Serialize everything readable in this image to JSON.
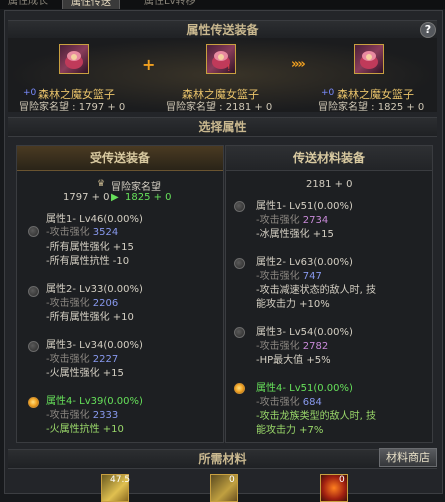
{
  "tabs": [
    {
      "label": "属性成长"
    },
    {
      "label": "属性传送"
    },
    {
      "label": "属性Lv转移"
    }
  ],
  "headers": {
    "transfer_equipment": "属性传送装备",
    "select_attribute": "选择属性",
    "required_materials": "所需材料"
  },
  "help_label": "?",
  "transfer": {
    "left": {
      "stack": "+0",
      "name": "森林之魔女篮子",
      "reputation": "冒险家名望 : 1797 + 0"
    },
    "center": {
      "name": "森林之魔女篮子",
      "reputation": "冒险家名望 : 2181 + 0"
    },
    "right": {
      "stack": "+0",
      "name": "森林之魔女篮子",
      "reputation": "冒险家名望 : 1825 + 0"
    },
    "plus_symbol": "+",
    "arrow_symbol": "»»"
  },
  "receiver_panel": {
    "title": "受传送装备",
    "rep_label": "冒险家名望",
    "rep_from": "1797 + 0",
    "rep_arrow": "▶",
    "rep_to": "1825 + 0",
    "attributes": [
      {
        "title": "属性1- Lv46(0.00%)",
        "lines": [
          {
            "text": "-攻击强化",
            "value": "3524"
          },
          {
            "text": "-所有属性强化 +15"
          },
          {
            "text": "-所有属性抗性 -10"
          }
        ]
      },
      {
        "title": "属性2- Lv33(0.00%)",
        "lines": [
          {
            "text": "-攻击强化",
            "value": "2206"
          },
          {
            "text": "-所有属性强化 +10"
          }
        ]
      },
      {
        "title": "属性3- Lv34(0.00%)",
        "lines": [
          {
            "text": "-攻击强化",
            "value": "2227"
          },
          {
            "text": "-火属性强化 +15"
          }
        ]
      },
      {
        "title": "属性4- Lv39(0.00%)",
        "lines": [
          {
            "text": "-攻击强化",
            "value": "2333"
          },
          {
            "text": "-火属性抗性 +10"
          }
        ]
      }
    ]
  },
  "source_panel": {
    "title": "传送材料装备",
    "rep": "2181 + 0",
    "attributes": [
      {
        "title": "属性1- Lv51(0.00%)",
        "lines": [
          {
            "text": "-攻击强化",
            "value": "2734"
          },
          {
            "text": "-冰属性强化 +15"
          }
        ]
      },
      {
        "title": "属性2- Lv63(0.00%)",
        "lines": [
          {
            "text": "-攻击强化",
            "value": "747"
          },
          {
            "text": "-攻击减速状态的敌人时, 技"
          },
          {
            "text": "  能攻击力 +10%"
          }
        ]
      },
      {
        "title": "属性3- Lv54(0.00%)",
        "lines": [
          {
            "text": "-攻击强化",
            "value": "2782"
          },
          {
            "text": "-HP最大值 +5%"
          }
        ]
      },
      {
        "title": "属性4- Lv51(0.00%)",
        "lines": [
          {
            "text": "-攻击强化",
            "value": "684"
          },
          {
            "text": "-攻击龙族类型的敌人时, 技"
          },
          {
            "text": "  能攻击力 +7%"
          }
        ]
      }
    ]
  },
  "shop_button": "材料商店",
  "materials": [
    {
      "count": "47.5"
    },
    {
      "count": "0"
    },
    {
      "count": "0"
    }
  ],
  "colors": {
    "selected_attribute": "#66e05a",
    "accent_gold": "#e9c36a",
    "attack_value": "#8899ee"
  }
}
